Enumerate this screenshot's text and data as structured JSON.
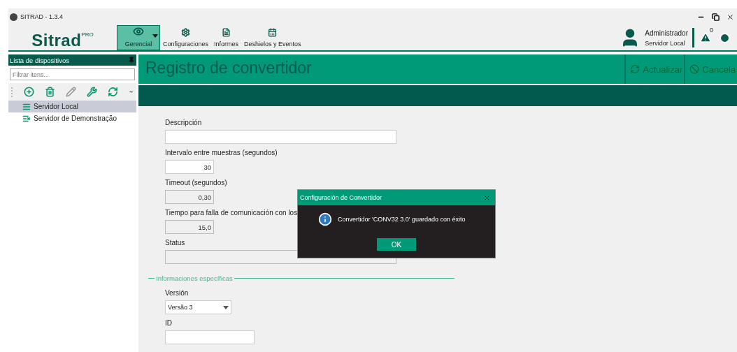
{
  "window": {
    "title": "SITRAD - 1.3.4"
  },
  "logo": {
    "text": "Sitrad",
    "superscript": "PRO"
  },
  "toolbar": [
    {
      "label": "Gerencial",
      "selected": true
    },
    {
      "label": "Configuraciones",
      "selected": false
    },
    {
      "label": "Informes",
      "selected": false
    },
    {
      "label": "Deshielos y Eventos",
      "selected": false
    }
  ],
  "user": {
    "name": "Administrador",
    "server": "Servidor Local"
  },
  "alerts": {
    "count": "0"
  },
  "sidebar": {
    "title": "Lista de dispositivos",
    "filter_placeholder": "Filtrar itens...",
    "tools": [
      {
        "disabled": false
      },
      {
        "disabled": false
      },
      {
        "disabled": true
      },
      {
        "disabled": false
      },
      {
        "disabled": false
      }
    ],
    "items": [
      {
        "label": "Servidor Local",
        "selected": true
      },
      {
        "label": "Servidor de Demonstração",
        "selected": false
      }
    ]
  },
  "page": {
    "title": "Registro de convertidor",
    "actions": [
      "Actualizar",
      "Cancela"
    ]
  },
  "form": {
    "fields": [
      {
        "kind": "text",
        "label": "Descripción",
        "disabled": false
      },
      {
        "kind": "text",
        "label": "Intervalo entre muestras (segundos)",
        "value": "30",
        "disabled": false
      },
      {
        "kind": "text",
        "label": "Timeout (segundos)",
        "value": "0,30",
        "disabled": true
      },
      {
        "kind": "text",
        "label": "Tiempo para falla de comunicación con los",
        "value": "15,0",
        "disabled": true
      },
      {
        "kind": "text",
        "label": "Status",
        "disabled": true
      }
    ],
    "section": {
      "title": "Informaciones específicas",
      "fields": [
        {
          "kind": "select",
          "label": "Versión",
          "value": "Versão 3"
        },
        {
          "kind": "text",
          "label": "ID"
        }
      ]
    }
  },
  "dialog": {
    "title": "Configuración de Convertidor",
    "message": "Convertidor 'CONV32 3.0' guardado con éxito",
    "button": "OK"
  }
}
